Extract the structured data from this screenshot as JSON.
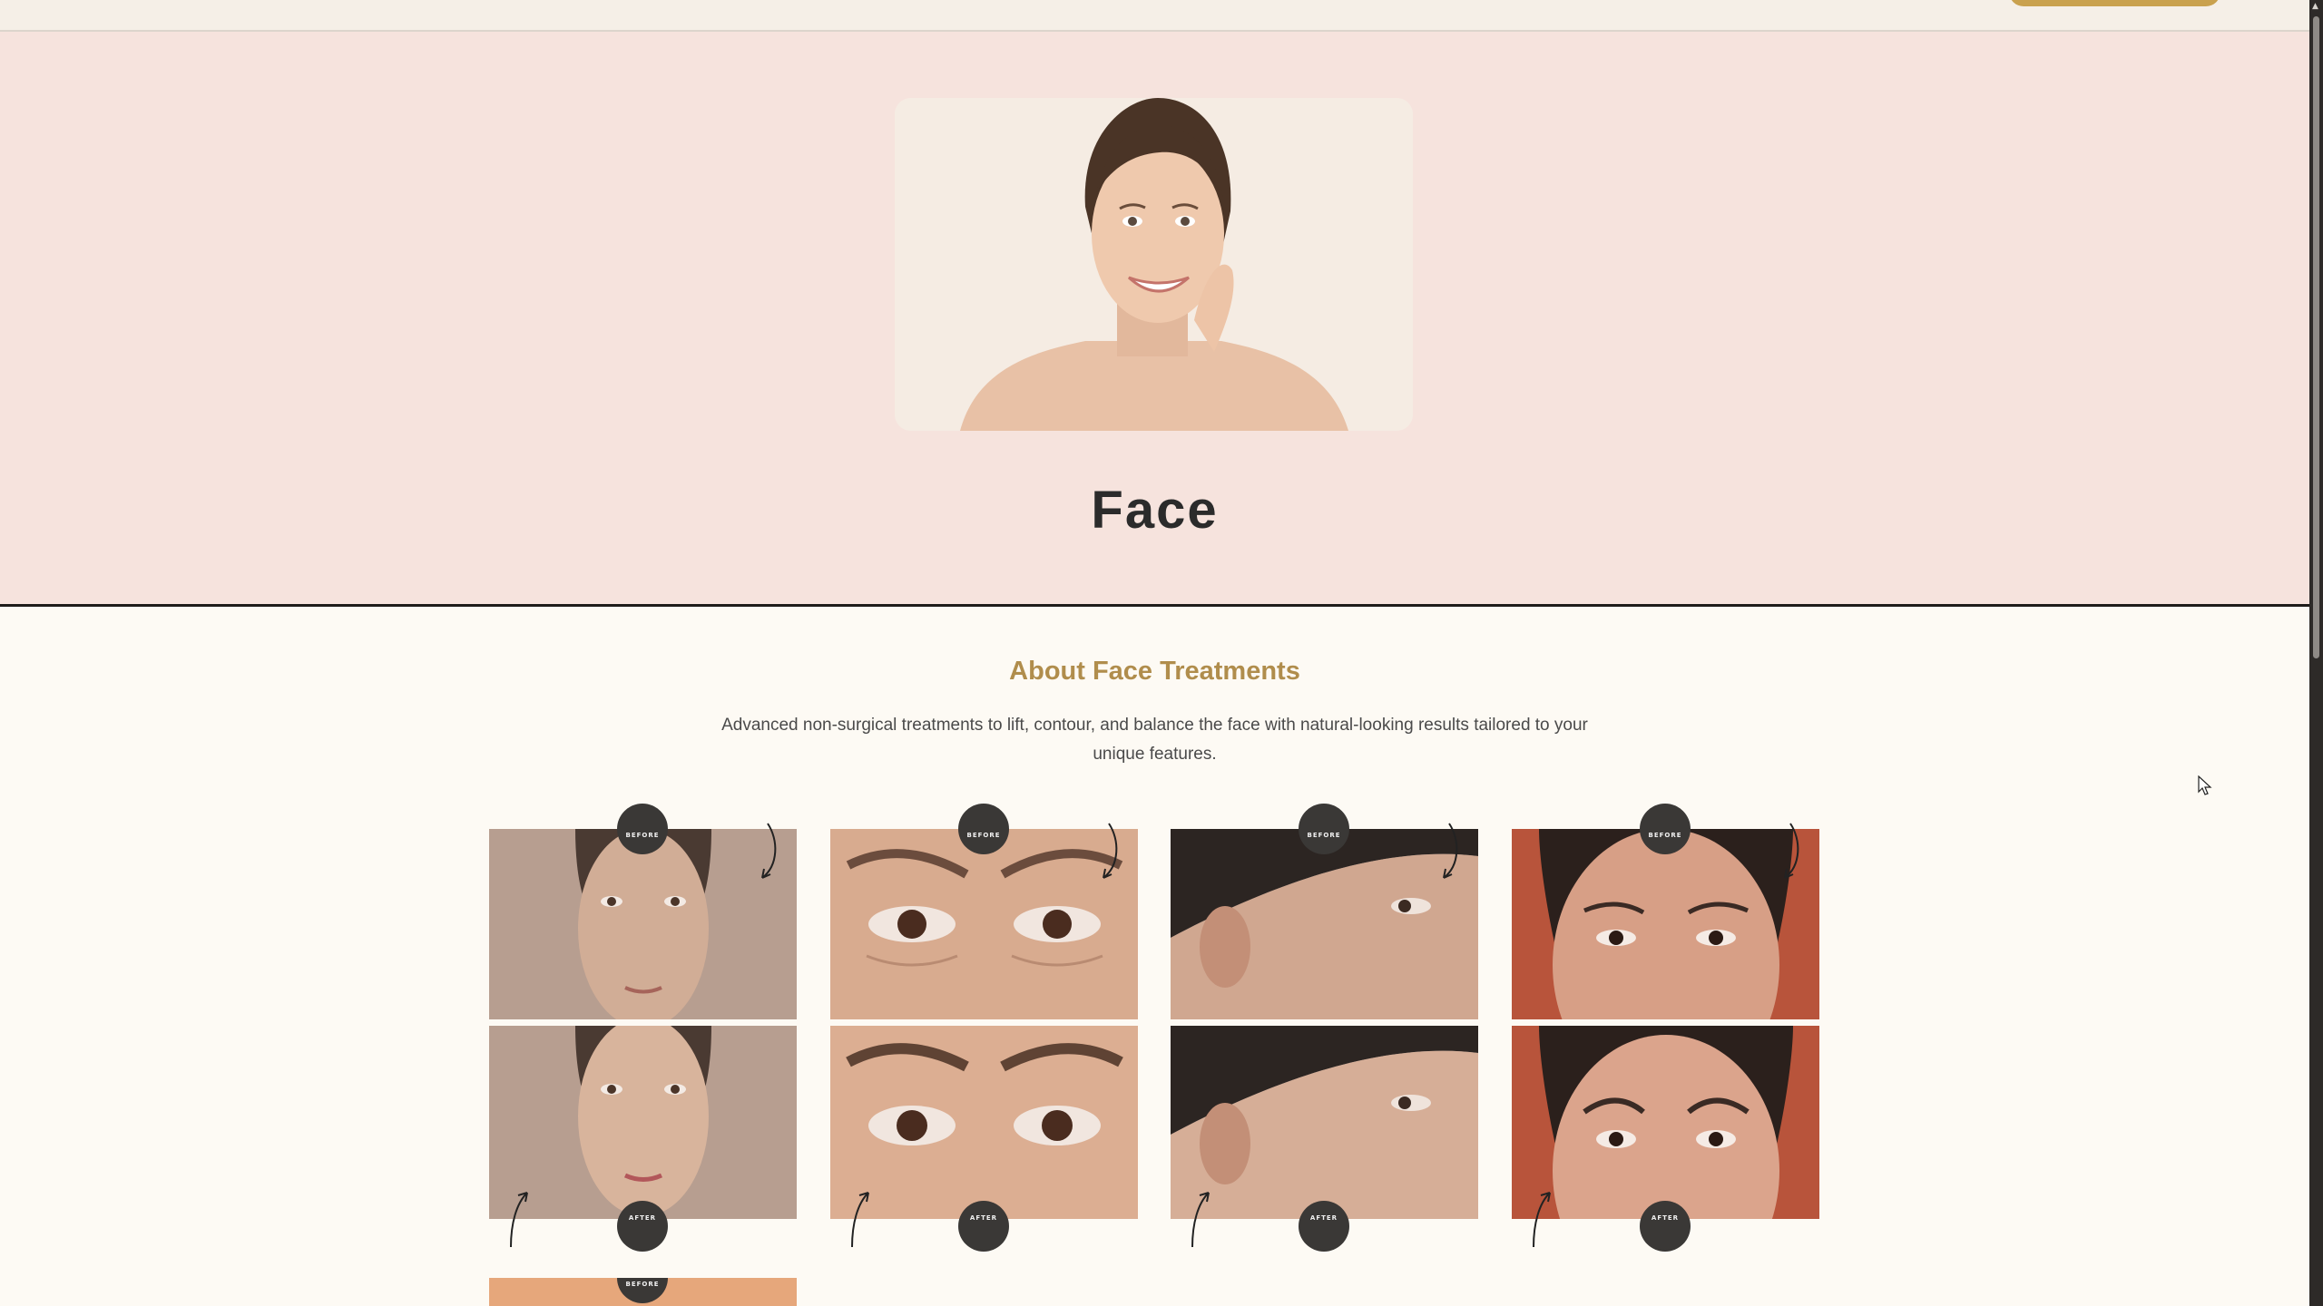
{
  "hero": {
    "title": "Face"
  },
  "about": {
    "title": "About Face Treatments",
    "description": "Advanced non-surgical treatments to lift, contour, and balance the face with natural-looking results tailored to your unique features."
  },
  "gallery": {
    "before_label": "BEFORE",
    "after_label": "AFTER",
    "cards": [
      {
        "name": "full-face",
        "bg": "#b79e90",
        "skin": "#d1ad96"
      },
      {
        "name": "eye-area",
        "bg": "#c99f84",
        "skin": "#d8ab8f"
      },
      {
        "name": "temple-profile",
        "bg": "#8a8c8f",
        "skin": "#d0a790"
      },
      {
        "name": "brow-area",
        "bg": "#b8543b",
        "skin": "#d79f86"
      }
    ]
  },
  "colors": {
    "accent": "#c9a14e",
    "hero_bg": "#f6e3dd",
    "heading_gold": "#b08d4c",
    "badge_bg": "#3a3836",
    "page_bg": "#fdfaf4"
  }
}
